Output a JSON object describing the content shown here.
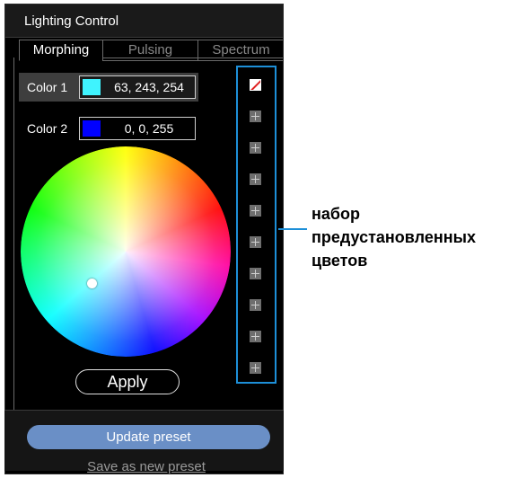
{
  "window": {
    "title": "Lighting Control"
  },
  "tabs": [
    {
      "label": "Morphing",
      "active": true
    },
    {
      "label": "Pulsing",
      "active": false
    },
    {
      "label": "Spectrum",
      "active": false
    }
  ],
  "colors": {
    "color1": {
      "label": "Color 1",
      "value": "63, 243, 254",
      "swatch": "#3ff3fe"
    },
    "color2": {
      "label": "Color 2",
      "value": "0, 0, 255",
      "swatch": "#0000ff"
    }
  },
  "wheel": {
    "handle_icon": "color-picker-handle"
  },
  "buttons": {
    "apply": "Apply",
    "update_preset": "Update preset",
    "save_as_new_preset": "Save as new preset"
  },
  "presets": {
    "slots": [
      {
        "type": "none",
        "icon": "no-color-icon"
      },
      {
        "type": "add",
        "icon": "plus-icon"
      },
      {
        "type": "add",
        "icon": "plus-icon"
      },
      {
        "type": "add",
        "icon": "plus-icon"
      },
      {
        "type": "add",
        "icon": "plus-icon"
      },
      {
        "type": "add",
        "icon": "plus-icon"
      },
      {
        "type": "add",
        "icon": "plus-icon"
      },
      {
        "type": "add",
        "icon": "plus-icon"
      },
      {
        "type": "add",
        "icon": "plus-icon"
      },
      {
        "type": "add",
        "icon": "plus-icon"
      }
    ]
  },
  "callout": {
    "lines": [
      "набор",
      "предустановленных",
      "цветов"
    ]
  },
  "theme": {
    "panel_bg": "#000000",
    "accent": "#1d8fd8",
    "update_button": "#6a8fc6"
  }
}
